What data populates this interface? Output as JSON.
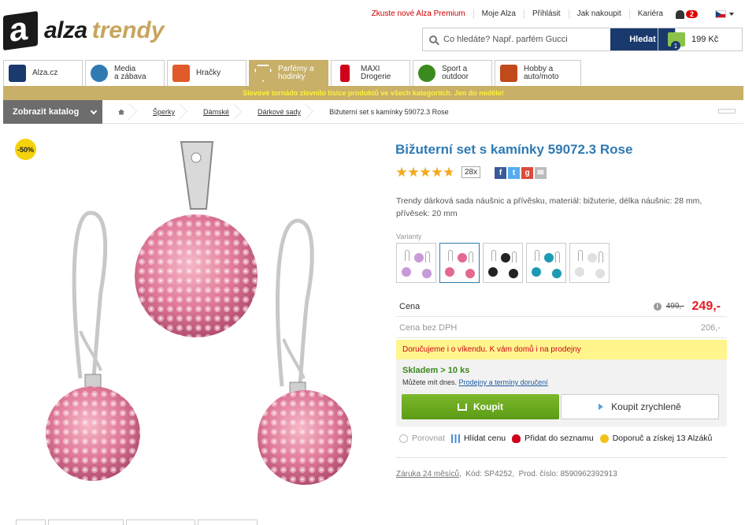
{
  "header": {
    "logo_alza": "alza",
    "logo_trendy": "trendy",
    "top_links": [
      "Zkuste nové Alza Premium",
      "Moje Alza",
      "Přihlásit",
      "Jak nakoupit",
      "Kariéra"
    ],
    "notifications_count": "2",
    "search_placeholder": "Co hledáte? Např. parfém Gucci",
    "search_button": "Hledat",
    "cart_total": "199 Kč",
    "cart_count": "1"
  },
  "tabs": [
    {
      "label1": "Alza.cz",
      "label2": "",
      "icon": "laptop-icon",
      "color": "#1a3a6e"
    },
    {
      "label1": "Media",
      "label2": "a zábava",
      "icon": "play-icon",
      "color": "#2f7ab3"
    },
    {
      "label1": "Hračky",
      "label2": "",
      "icon": "robot-icon",
      "color": "#e05a2a"
    },
    {
      "label1": "Parfémy a",
      "label2": "hodinky",
      "icon": "diamond-icon",
      "color": "#ffffff"
    },
    {
      "label1": "MAXI",
      "label2": "Drogerie",
      "icon": "bottle-icon",
      "color": "#d0021b"
    },
    {
      "label1": "Sport a",
      "label2": "outdoor",
      "icon": "bike-icon",
      "color": "#3a8a1d"
    },
    {
      "label1": "Hobby a",
      "label2": "auto/moto",
      "icon": "drill-icon",
      "color": "#c04a1a"
    }
  ],
  "promo": "Slevové tornádo zlevnilo tisíce produktů ve všech kategoriích. Jen do neděle!",
  "breadcrumb": {
    "catalog_button": "Zobrazit katalog",
    "items": [
      "Šperky",
      "Dámské",
      "Dárkové sady",
      "Bižuterní set s kamínky 59072.3 Rose"
    ]
  },
  "product": {
    "discount": "-50%",
    "title": "Bižuterní set s kamínky 59072.3 Rose",
    "rating": 4.7,
    "review_count": "28x",
    "description": "Trendy dárková sada náušnic a přívěsku, materiál: bižuterie, délka náušnic: 28 mm, přívěsek: 20 mm",
    "variants_label": "Varianty",
    "variant_colors": [
      "#c79ad8",
      "#e26a8e",
      "#222222",
      "#1c9bb3",
      "#e0e0e0"
    ],
    "selected_variant": 1,
    "price_label": "Cena",
    "info_icon": "i",
    "old_price": "499,-",
    "new_price": "249,-",
    "price_no_vat_label": "Cena bez DPH",
    "price_no_vat": "206,-",
    "delivery_note": "Doručujeme i o víkendu. K vám domů i na prodejny",
    "stock": "Skladem > 10 ks",
    "stock_sub": "Můžete mít dnes.",
    "stock_link": "Prodejny a termíny doručení",
    "buy_button": "Koupit",
    "fast_buy_button": "Koupit zrychleně",
    "actions": [
      "Porovnat",
      "Hlídat cenu",
      "Přidat do seznamu",
      "Doporuč a získej 13 Alzáků"
    ],
    "warranty": "Záruka 24 měsíců",
    "code": "Kód: SP4252",
    "prod_number": "Prod. číslo: 8590962392913"
  }
}
